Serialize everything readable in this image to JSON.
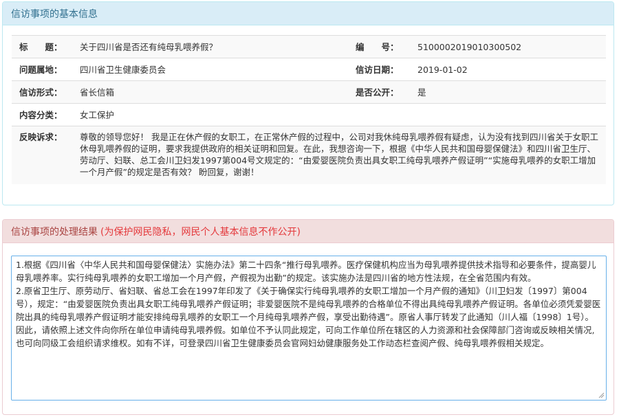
{
  "basic_info": {
    "heading": "信访事项的基本信息",
    "rows": [
      {
        "label": "标　　题：",
        "value": "关于四川省是否还有纯母乳喂养假？",
        "label2": "编　　号：",
        "value2": "5100002019010300502"
      },
      {
        "label": "问题属地：",
        "value": "四川省卫生健康委员会",
        "label2": "信访日期：",
        "value2": "2019-01-02"
      },
      {
        "label": "信访形式：",
        "value": "省长信箱",
        "label2": "是否公开：",
        "value2": "是"
      },
      {
        "label": "内容分类：",
        "value": "女工保护"
      },
      {
        "label": "反映诉求：",
        "value": "尊敬的领导您好！ 我是正在休产假的女职工，在正常休产假的过程中，公司对我休纯母乳喂养假有疑虑，认为没有找到四川省关于女职工休母乳喂养假的证明，要求我提供政府的相关证明和回复。在此，我想咨询一下，根据《中华人民共和国母婴保健法》和四川省卫生厅、劳动厅、妇联、总工会川卫妇发1997第004号文规定的：“由爱婴医院负责出具女职工纯母乳喂养产假证明”“实施母乳喂养的女职工增加一个月产假”的规定是否有效？ 盼回复，谢谢！"
      }
    ]
  },
  "result": {
    "heading": "信访事项的处理结果",
    "privacy_note": "(为保护网民隐私，网民个人基本信息不作公开)",
    "paragraphs": [
      "1.根据《四川省〈中华人民共和国母婴保健法〉实施办法》第二十四条“推行母乳喂养。医疗保健机构应当为母乳喂养提供技术指导和必要条件，提高婴儿母乳喂养率。实行纯母乳喂养的女职工增加一个月产假，产假视为出勤”的规定。该实施办法是四川省的地方性法规，在全省范围内有效。",
      "2.原省卫生厅、原劳动厅、省妇联、省总工会在1997年印发了《关于确保实行纯母乳喂养的女职工增加一个月产假的通知》（川卫妇发〔1997〕第004号），规定：“由爱婴医院负责出具女职工纯母乳喂养产假证明；非爱婴医院不是纯母乳喂养的合格单位不得出具纯母乳喂养产假证明。各单位必须凭爱婴医院出具的纯母乳喂养产假证明才能安排纯母乳喂养的女职工一个月纯母乳喂养产假，享受出勤待遇”。原省人事厅转发了此通知（川人福〔1998〕1号）。",
      "因此，请依照上述文件向你所在单位申请纯母乳喂养假。如单位不予认同此规定，可向工作单位所在辖区的人力资源和社会保障部门咨询或反映相关情况,也可向同级工会组织请求维权。如有不详，可登录四川省卫生健康委员会官网妇幼健康服务处工作动态栏查阅产假、纯母乳喂养假相关规定。"
    ]
  }
}
